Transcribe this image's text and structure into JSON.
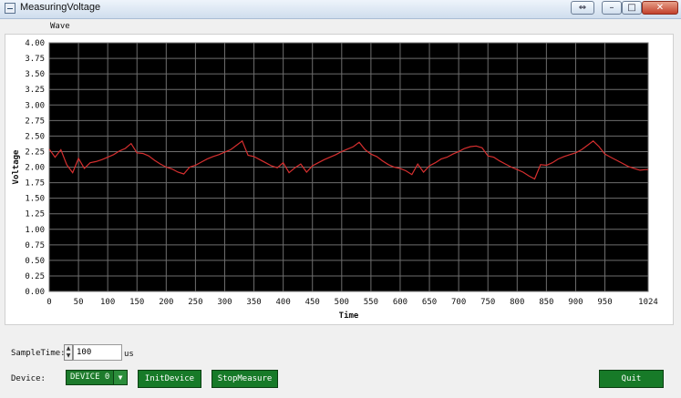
{
  "window": {
    "title": "MeasuringVoltage",
    "restore_label": "⇔",
    "minimize_label": "–",
    "maximize_label": "□",
    "close_label": "✕"
  },
  "section": {
    "title": "Wave"
  },
  "controls": {
    "sample_time_label": "SampleTime:",
    "sample_time_value": "100",
    "sample_time_unit": "us",
    "device_label": "Device:",
    "device_value": "DEVICE 0",
    "init_button": "InitDevice",
    "stop_button": "StopMeasure",
    "quit_button": "Quit"
  },
  "chart_data": {
    "type": "line",
    "xlabel": "Time",
    "ylabel": "Voltage",
    "xlim": [
      0,
      1024
    ],
    "ylim": [
      0,
      4
    ],
    "xticks": [
      "0",
      "50",
      "100",
      "150",
      "200",
      "250",
      "300",
      "350",
      "400",
      "450",
      "500",
      "550",
      "600",
      "650",
      "700",
      "750",
      "800",
      "850",
      "900",
      "950",
      "1024"
    ],
    "yticks": [
      "0.00",
      "0.25",
      "0.50",
      "0.75",
      "1.00",
      "1.25",
      "1.50",
      "1.75",
      "2.00",
      "2.25",
      "2.50",
      "2.75",
      "3.00",
      "3.25",
      "3.50",
      "3.75",
      "4.00"
    ],
    "grid": true,
    "series": [
      {
        "color": "#d62f2f",
        "x": [
          0,
          10,
          20,
          30,
          40,
          50,
          60,
          70,
          80,
          90,
          100,
          110,
          120,
          130,
          140,
          150,
          160,
          170,
          180,
          190,
          200,
          210,
          220,
          230,
          240,
          250,
          260,
          270,
          280,
          290,
          300,
          310,
          320,
          330,
          340,
          350,
          360,
          370,
          380,
          390,
          400,
          410,
          420,
          430,
          440,
          450,
          460,
          470,
          480,
          490,
          500,
          510,
          520,
          530,
          540,
          550,
          560,
          570,
          580,
          590,
          600,
          610,
          620,
          630,
          640,
          650,
          660,
          670,
          680,
          690,
          700,
          710,
          720,
          730,
          740,
          750,
          760,
          770,
          780,
          790,
          800,
          810,
          820,
          830,
          840,
          850,
          860,
          870,
          880,
          890,
          900,
          910,
          920,
          930,
          940,
          950,
          960,
          970,
          980,
          990,
          1000,
          1010,
          1020,
          1024
        ],
        "y": [
          2.29,
          2.16,
          2.28,
          2.04,
          1.91,
          2.14,
          1.98,
          2.07,
          2.09,
          2.12,
          2.16,
          2.2,
          2.26,
          2.3,
          2.38,
          2.23,
          2.22,
          2.18,
          2.11,
          2.05,
          2.0,
          1.97,
          1.92,
          1.89,
          2.0,
          2.03,
          2.08,
          2.13,
          2.17,
          2.2,
          2.24,
          2.28,
          2.35,
          2.42,
          2.19,
          2.17,
          2.12,
          2.07,
          2.02,
          1.99,
          2.07,
          1.91,
          1.99,
          2.05,
          1.92,
          2.02,
          2.07,
          2.12,
          2.16,
          2.2,
          2.25,
          2.29,
          2.33,
          2.4,
          2.28,
          2.21,
          2.17,
          2.1,
          2.04,
          2.0,
          1.98,
          1.94,
          1.88,
          2.05,
          1.92,
          2.02,
          2.07,
          2.13,
          2.16,
          2.21,
          2.25,
          2.3,
          2.33,
          2.34,
          2.31,
          2.18,
          2.16,
          2.1,
          2.05,
          2.0,
          1.96,
          1.92,
          1.86,
          1.81,
          2.04,
          2.03,
          2.07,
          2.13,
          2.17,
          2.2,
          2.23,
          2.28,
          2.35,
          2.42,
          2.33,
          2.21,
          2.16,
          2.11,
          2.06,
          2.01,
          1.98,
          1.95,
          1.96,
          1.96
        ]
      }
    ]
  }
}
